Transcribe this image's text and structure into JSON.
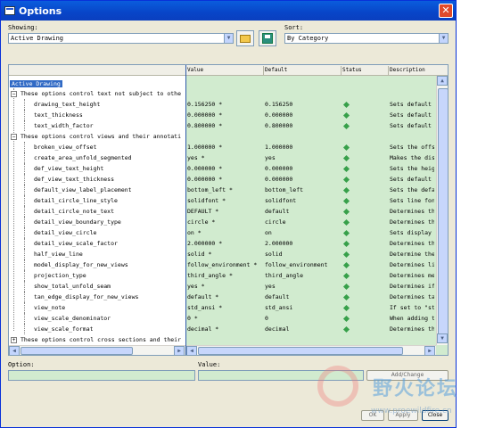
{
  "window": {
    "title": "Options",
    "close_glyph": "✕"
  },
  "showing": {
    "label": "Showing:",
    "value": "Active Drawing"
  },
  "sort": {
    "label": "Sort:",
    "value": "By Category"
  },
  "toolbar": {
    "open_icon": "open-folder-icon",
    "save_icon": "save-icon"
  },
  "columns": [
    "Value",
    "Default",
    "Status",
    "Description"
  ],
  "root": "Active Drawing",
  "groups": [
    {
      "label": "These options control text not subject to othe",
      "expanded": true,
      "rows": [
        {
          "name": "drawing_text_height",
          "value": "0.156250 *",
          "default": "0.156250",
          "description": "Sets default t"
        },
        {
          "name": "text_thickness",
          "value": "0.000000 *",
          "default": "0.000000",
          "description": "Sets default t"
        },
        {
          "name": "text_width_factor",
          "value": "0.800000 *",
          "default": "0.800000",
          "description": "Sets default r"
        }
      ]
    },
    {
      "label": "These options control views and their annotati",
      "expanded": true,
      "rows": [
        {
          "name": "broken_view_offset",
          "value": "1.000000 *",
          "default": "1.000000",
          "description": "Sets the offse"
        },
        {
          "name": "create_area_unfold_segmented",
          "value": "yes *",
          "default": "yes",
          "description": "Makes the disp"
        },
        {
          "name": "def_view_text_height",
          "value": "0.000000 *",
          "default": "0.000000",
          "description": "Sets the heigh"
        },
        {
          "name": "def_view_text_thickness",
          "value": "0.000000 *",
          "default": "0.000000",
          "description": "Sets default t"
        },
        {
          "name": "default_view_label_placement",
          "value": "bottom_left *",
          "default": "bottom_left",
          "description": "Sets the defau"
        },
        {
          "name": "detail_circle_line_style",
          "value": "solidfont *",
          "default": "solidfont",
          "description": "Sets line font"
        },
        {
          "name": "detail_circle_note_text",
          "value": "DEFAULT *",
          "default": "default",
          "description": "Determines the"
        },
        {
          "name": "detail_view_boundary_type",
          "value": "circle *",
          "default": "circle",
          "description": "Determines the"
        },
        {
          "name": "detail_view_circle",
          "value": "on *",
          "default": "on",
          "description": "Sets display o"
        },
        {
          "name": "detail_view_scale_factor",
          "value": "2.000000 *",
          "default": "2.000000",
          "description": "Determines the"
        },
        {
          "name": "half_view_line",
          "value": "solid *",
          "default": "solid",
          "description": "Determine the"
        },
        {
          "name": "model_display_for_new_views",
          "value": "follow_environment *",
          "default": "follow_environment",
          "description": "Determines lin"
        },
        {
          "name": "projection_type",
          "value": "third_angle *",
          "default": "third_angle",
          "description": "Determines met"
        },
        {
          "name": "show_total_unfold_seam",
          "value": "yes *",
          "default": "yes",
          "description": "Determines if"
        },
        {
          "name": "tan_edge_display_for_new_views",
          "value": "default *",
          "default": "default",
          "description": "Determines tan"
        },
        {
          "name": "view_note",
          "value": "std_ansi *",
          "default": "std_ansi",
          "description": "If set to \"std"
        },
        {
          "name": "view_scale_denominator",
          "value": "0 *",
          "default": "0",
          "description": "When adding th"
        },
        {
          "name": "view_scale_format",
          "value": "decimal *",
          "default": "decimal",
          "description": "Determines the"
        }
      ]
    },
    {
      "label": "These options control cross sections and their",
      "expanded": false,
      "rows": []
    }
  ],
  "option_field": {
    "label": "Option:",
    "value": ""
  },
  "value_field": {
    "label": "Value:",
    "value": ""
  },
  "buttons": {
    "add_change": "Add/Change",
    "ok": "OK",
    "apply": "Apply",
    "close": "Close"
  },
  "watermark": {
    "text": "野火论坛",
    "url": "www.proewildfire.cn"
  },
  "colors": {
    "grid_bg": "#d1ebcf",
    "status_ok": "#37a04a",
    "title_bar": "#0a5ddd"
  }
}
